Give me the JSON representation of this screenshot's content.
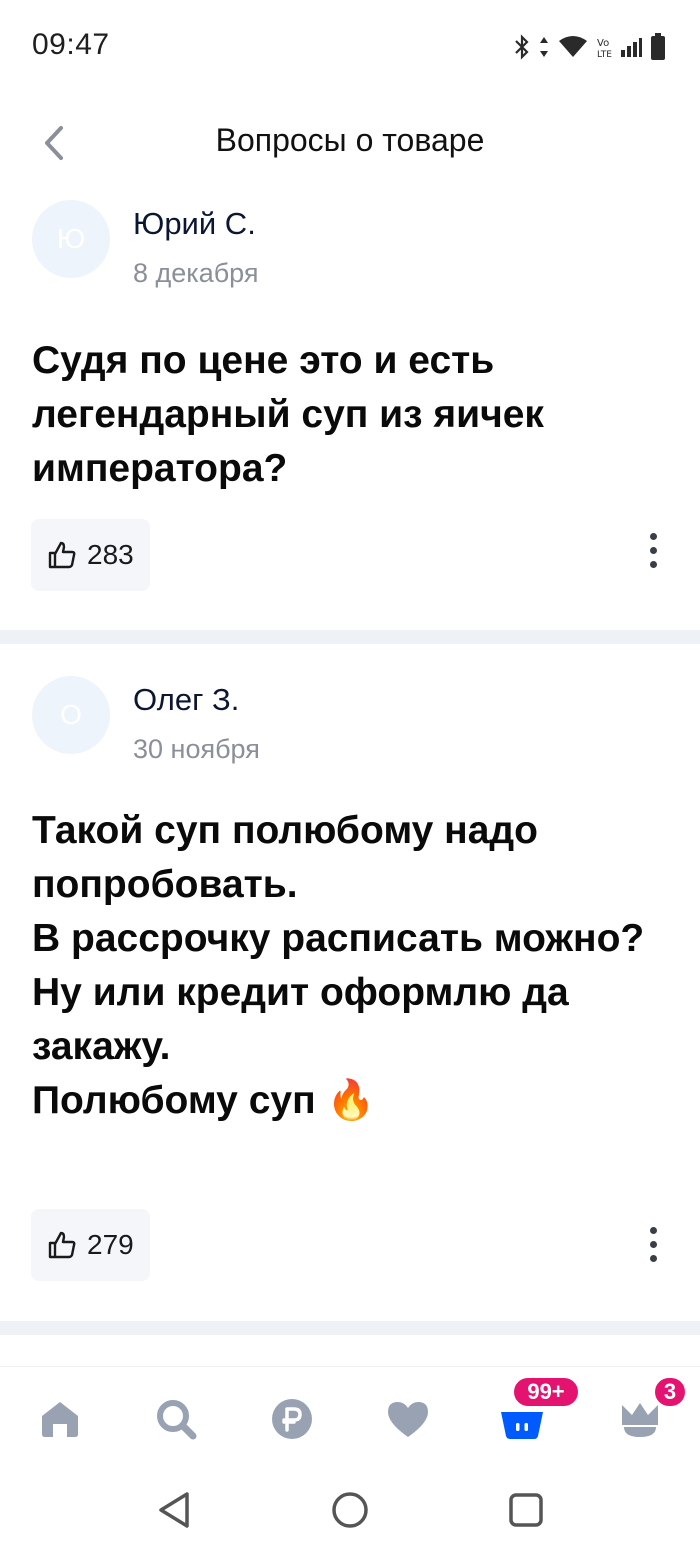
{
  "status_bar": {
    "time": "09:47",
    "icons": [
      "bluetooth-icon",
      "data-arrows-icon",
      "wifi-icon",
      "volte-icon",
      "signal-icon",
      "battery-icon"
    ]
  },
  "header": {
    "back_icon": "chevron-left-icon",
    "title": "Вопросы о товаре"
  },
  "questions": [
    {
      "avatar_initial": "Ю",
      "author": "Юрий С.",
      "date": "8 декабря",
      "text": "Судя по цене это и есть легендарный суп из яичек императора?",
      "likes": "283"
    },
    {
      "avatar_initial": "О",
      "author": "Олег З.",
      "date": "30 ноября",
      "text": "Такой суп полюбому надо попробовать.\nВ рассрочку расписать можно?\nНу или кредит оформлю да закажу.\nПолюбому суп 🔥",
      "likes": "279"
    }
  ],
  "bottom_nav": {
    "items": [
      "home-icon",
      "search-icon",
      "ruble-icon",
      "heart-icon",
      "cart-icon",
      "profile-icon"
    ],
    "cart_badge": "99+",
    "profile_badge": "3",
    "active_color": "#005bff",
    "inactive_color": "#98a2b3",
    "badge_color": "#e3136f"
  },
  "system_nav": [
    "back-triangle-icon",
    "home-circle-icon",
    "recents-square-icon"
  ]
}
